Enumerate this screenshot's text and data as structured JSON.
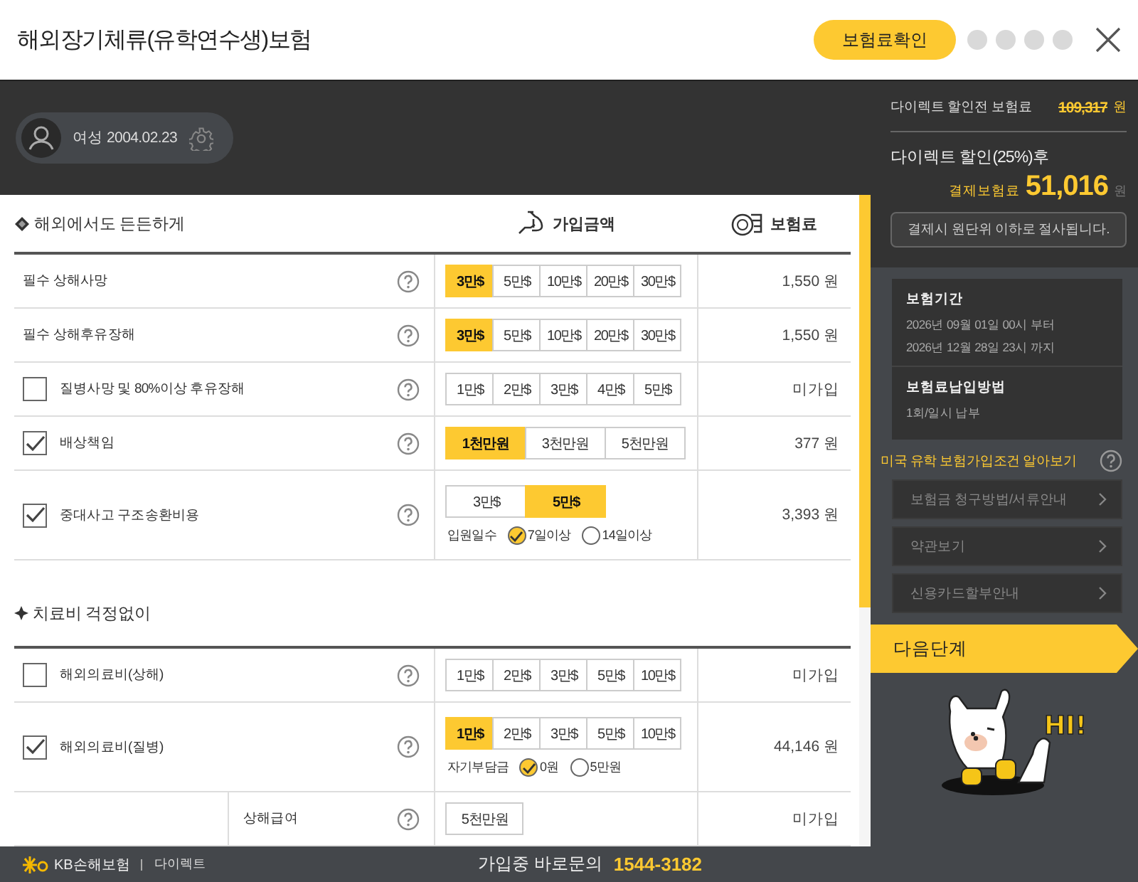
{
  "window": {
    "title": "해외장기체류(유학연수생)보험",
    "check_button": "보험료확인"
  },
  "profile": {
    "text": "여성 2004.02.23"
  },
  "table": {
    "columns": {
      "amount": "가입금액",
      "premium": "보험료"
    },
    "sections": [
      {
        "title": "해외에서도 든든하게",
        "rows": [
          {
            "kind": "plain",
            "label": "필수 상해사망",
            "options": [
              {
                "label": "3만$",
                "selected": true
              },
              {
                "label": "5만$",
                "selected": false
              },
              {
                "label": "10만$",
                "selected": false
              },
              {
                "label": "20만$",
                "selected": false
              },
              {
                "label": "30만$",
                "selected": false
              }
            ],
            "premium": "1,550 원"
          },
          {
            "kind": "plain",
            "label": "필수 상해후유장해",
            "options": [
              {
                "label": "3만$",
                "selected": true
              },
              {
                "label": "5만$",
                "selected": false
              },
              {
                "label": "10만$",
                "selected": false
              },
              {
                "label": "20만$",
                "selected": false
              },
              {
                "label": "30만$",
                "selected": false
              }
            ],
            "premium": "1,550 원"
          },
          {
            "kind": "check",
            "checked": false,
            "label": "질병사망 및 80%이상 후유장해",
            "options": [
              {
                "label": "1만$",
                "selected": false
              },
              {
                "label": "2만$",
                "selected": false
              },
              {
                "label": "3만$",
                "selected": false
              },
              {
                "label": "4만$",
                "selected": false
              },
              {
                "label": "5만$",
                "selected": false
              }
            ],
            "premium": "미가입"
          },
          {
            "kind": "check",
            "checked": true,
            "label": "배상책임",
            "options": [
              {
                "label": "1천만원",
                "selected": true
              },
              {
                "label": "3천만원",
                "selected": false
              },
              {
                "label": "5천만원",
                "selected": false
              }
            ],
            "premium": "377 원"
          },
          {
            "kind": "check",
            "checked": true,
            "label": "중대사고 구조송환비용",
            "options": [
              {
                "label": "3만$",
                "selected": false
              },
              {
                "label": "5만$",
                "selected": true
              }
            ],
            "radio": {
              "label": "입원일수",
              "choices": [
                {
                  "label": "7일이상",
                  "selected": true
                },
                {
                  "label": "14일이상",
                  "selected": false
                }
              ]
            },
            "premium": "3,393 원"
          }
        ]
      },
      {
        "title": "치료비 걱정없이",
        "rows": [
          {
            "kind": "check",
            "checked": false,
            "label": "해외의료비(상해)",
            "options": [
              {
                "label": "1만$",
                "selected": false
              },
              {
                "label": "2만$",
                "selected": false
              },
              {
                "label": "3만$",
                "selected": false
              },
              {
                "label": "5만$",
                "selected": false
              },
              {
                "label": "10만$",
                "selected": false
              }
            ],
            "premium": "미가입"
          },
          {
            "kind": "check",
            "checked": true,
            "label": "해외의료비(질병)",
            "options": [
              {
                "label": "1만$",
                "selected": true
              },
              {
                "label": "2만$",
                "selected": false
              },
              {
                "label": "3만$",
                "selected": false
              },
              {
                "label": "5만$",
                "selected": false
              },
              {
                "label": "10만$",
                "selected": false
              }
            ],
            "radio": {
              "label": "자기부담금",
              "choices": [
                {
                  "label": "0원",
                  "selected": true
                },
                {
                  "label": "5만원",
                  "selected": false
                }
              ]
            },
            "premium": "44,146 원"
          },
          {
            "kind": "sub",
            "label": "상해급여",
            "options": [
              {
                "label": "5천만원",
                "selected": false
              }
            ],
            "premium": "미가입"
          }
        ]
      }
    ]
  },
  "summary": {
    "before_label": "다이렉트 할인전 보험료",
    "before_amount": "109,317",
    "before_unit": "원",
    "after_title": "다이렉트 할인(25%)후",
    "pay_label": "결제보험료",
    "pay_amount": "51,016",
    "pay_unit": "원",
    "note": "결제시 원단위 이하로 절사됩니다."
  },
  "period": {
    "title": "보험기간",
    "lines": [
      "2026년 09월 01일 00시 부터",
      "2026년 12월 28일 23시 까지"
    ],
    "method_title": "보험료납입방법",
    "method": "1회/일시 납부"
  },
  "conditions_link": "미국 유학 보험가입조건 알아보기",
  "menu": [
    "보험금 청구방법/서류안내",
    "약관보기",
    "신용카드할부안내"
  ],
  "next_button": "다음단계",
  "mascot": {
    "greeting": "HI!"
  },
  "footer": {
    "brand": "KB손해보험",
    "sub_brand": "다이렉트",
    "contact_label": "가입중 바로문의",
    "phone": "1544-3182"
  }
}
